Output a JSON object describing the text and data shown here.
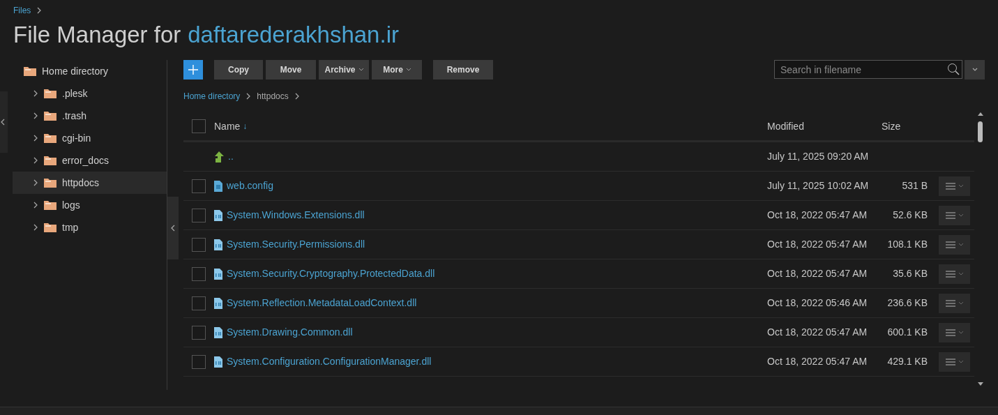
{
  "breadcrumb": [
    "Files"
  ],
  "title": {
    "prefix": "File Manager for",
    "domain": "daftarederakhshan.ir"
  },
  "tree": {
    "label": "Home directory",
    "children": [
      {
        "label": ".plesk",
        "selected": false
      },
      {
        "label": ".trash",
        "selected": false
      },
      {
        "label": "cgi-bin",
        "selected": false
      },
      {
        "label": "error_docs",
        "selected": false
      },
      {
        "label": "httpdocs",
        "selected": true
      },
      {
        "label": "logs",
        "selected": false
      },
      {
        "label": "tmp",
        "selected": false
      }
    ]
  },
  "toolbar": [
    {
      "label": "Copy",
      "dropdown": false
    },
    {
      "label": "Move",
      "dropdown": false
    },
    {
      "label": "Archive",
      "dropdown": true
    },
    {
      "label": "More",
      "dropdown": true
    },
    {
      "label": "Remove",
      "dropdown": false
    }
  ],
  "search": {
    "placeholder": "Search in filename"
  },
  "path": [
    "Home directory",
    "httpdocs"
  ],
  "table": {
    "columns": [
      "Name",
      "Modified",
      "Size"
    ],
    "sort_indicator": "↓",
    "select_all": {
      "checked": false
    },
    "rows": [
      {
        "kind": "up",
        "name": "..",
        "modified": "July 11, 2025 09:20 AM"
      },
      {
        "kind": "file",
        "name": "web.config",
        "modified": "July 11, 2025 10:02 AM",
        "size": "531 B",
        "checked": false
      },
      {
        "kind": "binary",
        "name": "System.Windows.Extensions.dll",
        "modified": "Oct 18, 2022 05:47 AM",
        "size": "52.6 KB",
        "checked": false
      },
      {
        "kind": "binary",
        "name": "System.Security.Permissions.dll",
        "modified": "Oct 18, 2022 05:47 AM",
        "size": "108.1 KB",
        "checked": false
      },
      {
        "kind": "binary",
        "name": "System.Security.Cryptography.ProtectedData.dll",
        "modified": "Oct 18, 2022 05:47 AM",
        "size": "35.6 KB",
        "checked": false
      },
      {
        "kind": "binary",
        "name": "System.Reflection.MetadataLoadContext.dll",
        "modified": "Oct 18, 2022 05:46 AM",
        "size": "236.6 KB",
        "checked": false
      },
      {
        "kind": "binary",
        "name": "System.Drawing.Common.dll",
        "modified": "Oct 18, 2022 05:47 AM",
        "size": "600.1 KB",
        "checked": false
      },
      {
        "kind": "binary",
        "name": "System.Configuration.ConfigurationManager.dll",
        "modified": "Oct 18, 2022 05:47 AM",
        "size": "429.1 KB",
        "checked": false
      }
    ]
  }
}
